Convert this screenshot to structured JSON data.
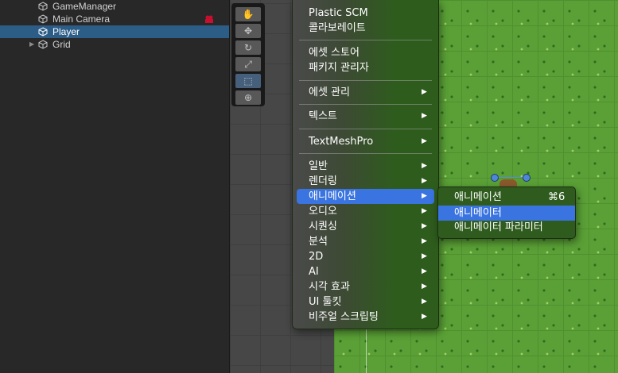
{
  "hierarchy": {
    "items": [
      {
        "label": "GameManager"
      },
      {
        "label": "Main Camera"
      },
      {
        "label": "Player"
      },
      {
        "label": "Grid"
      }
    ]
  },
  "tools": [
    {
      "icon": "hand-tool-icon",
      "glyph": "✋"
    },
    {
      "icon": "move-tool-icon",
      "glyph": "✥"
    },
    {
      "icon": "rotate-tool-icon",
      "glyph": "↻"
    },
    {
      "icon": "scale-tool-icon",
      "glyph": "⤢"
    },
    {
      "icon": "rect-tool-icon",
      "glyph": "⬚"
    },
    {
      "icon": "transform-tool-icon",
      "glyph": "⊕"
    }
  ],
  "menu": {
    "items": [
      {
        "label": "Plastic SCM"
      },
      {
        "label": "콜라보레이트"
      },
      {
        "label": "에셋 스토어"
      },
      {
        "label": "패키지 관리자"
      },
      {
        "label": "에셋 관리",
        "arrow": "▶"
      },
      {
        "label": "텍스트",
        "arrow": "▶"
      },
      {
        "label": "TextMeshPro",
        "arrow": "▶"
      },
      {
        "label": "일반",
        "arrow": "▶"
      },
      {
        "label": "렌더링",
        "arrow": "▶"
      },
      {
        "label": "애니메이션",
        "arrow": "▶"
      },
      {
        "label": "오디오",
        "arrow": "▶"
      },
      {
        "label": "시퀀싱",
        "arrow": "▶"
      },
      {
        "label": "분석",
        "arrow": "▶"
      },
      {
        "label": "2D",
        "arrow": "▶"
      },
      {
        "label": "AI",
        "arrow": "▶"
      },
      {
        "label": "시각 효과",
        "arrow": "▶"
      },
      {
        "label": "UI 툴킷",
        "arrow": "▶"
      },
      {
        "label": "비주얼 스크립팅",
        "arrow": "▶"
      }
    ]
  },
  "submenu": {
    "items": [
      {
        "label": "애니메이션",
        "shortcut": "⌘6"
      },
      {
        "label": "애니메이터",
        "shortcut": ""
      },
      {
        "label": "애니메이터 파라미터",
        "shortcut": ""
      }
    ]
  },
  "colors": {
    "selection": "#2c5d87",
    "menu_highlight": "#3a74e0",
    "grass": "#5aa036"
  }
}
